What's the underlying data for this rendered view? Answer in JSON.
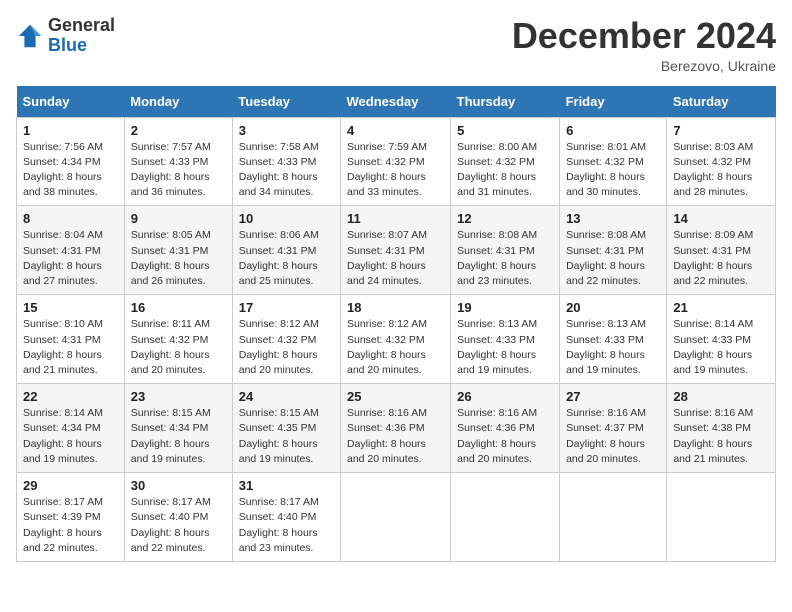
{
  "logo": {
    "general": "General",
    "blue": "Blue"
  },
  "title": "December 2024",
  "location": "Berezovo, Ukraine",
  "days_of_week": [
    "Sunday",
    "Monday",
    "Tuesday",
    "Wednesday",
    "Thursday",
    "Friday",
    "Saturday"
  ],
  "weeks": [
    [
      {
        "day": "1",
        "sunrise": "7:56 AM",
        "sunset": "4:34 PM",
        "daylight": "8 hours and 38 minutes."
      },
      {
        "day": "2",
        "sunrise": "7:57 AM",
        "sunset": "4:33 PM",
        "daylight": "8 hours and 36 minutes."
      },
      {
        "day": "3",
        "sunrise": "7:58 AM",
        "sunset": "4:33 PM",
        "daylight": "8 hours and 34 minutes."
      },
      {
        "day": "4",
        "sunrise": "7:59 AM",
        "sunset": "4:32 PM",
        "daylight": "8 hours and 33 minutes."
      },
      {
        "day": "5",
        "sunrise": "8:00 AM",
        "sunset": "4:32 PM",
        "daylight": "8 hours and 31 minutes."
      },
      {
        "day": "6",
        "sunrise": "8:01 AM",
        "sunset": "4:32 PM",
        "daylight": "8 hours and 30 minutes."
      },
      {
        "day": "7",
        "sunrise": "8:03 AM",
        "sunset": "4:32 PM",
        "daylight": "8 hours and 28 minutes."
      }
    ],
    [
      {
        "day": "8",
        "sunrise": "8:04 AM",
        "sunset": "4:31 PM",
        "daylight": "8 hours and 27 minutes."
      },
      {
        "day": "9",
        "sunrise": "8:05 AM",
        "sunset": "4:31 PM",
        "daylight": "8 hours and 26 minutes."
      },
      {
        "day": "10",
        "sunrise": "8:06 AM",
        "sunset": "4:31 PM",
        "daylight": "8 hours and 25 minutes."
      },
      {
        "day": "11",
        "sunrise": "8:07 AM",
        "sunset": "4:31 PM",
        "daylight": "8 hours and 24 minutes."
      },
      {
        "day": "12",
        "sunrise": "8:08 AM",
        "sunset": "4:31 PM",
        "daylight": "8 hours and 23 minutes."
      },
      {
        "day": "13",
        "sunrise": "8:08 AM",
        "sunset": "4:31 PM",
        "daylight": "8 hours and 22 minutes."
      },
      {
        "day": "14",
        "sunrise": "8:09 AM",
        "sunset": "4:31 PM",
        "daylight": "8 hours and 22 minutes."
      }
    ],
    [
      {
        "day": "15",
        "sunrise": "8:10 AM",
        "sunset": "4:31 PM",
        "daylight": "8 hours and 21 minutes."
      },
      {
        "day": "16",
        "sunrise": "8:11 AM",
        "sunset": "4:32 PM",
        "daylight": "8 hours and 20 minutes."
      },
      {
        "day": "17",
        "sunrise": "8:12 AM",
        "sunset": "4:32 PM",
        "daylight": "8 hours and 20 minutes."
      },
      {
        "day": "18",
        "sunrise": "8:12 AM",
        "sunset": "4:32 PM",
        "daylight": "8 hours and 20 minutes."
      },
      {
        "day": "19",
        "sunrise": "8:13 AM",
        "sunset": "4:33 PM",
        "daylight": "8 hours and 19 minutes."
      },
      {
        "day": "20",
        "sunrise": "8:13 AM",
        "sunset": "4:33 PM",
        "daylight": "8 hours and 19 minutes."
      },
      {
        "day": "21",
        "sunrise": "8:14 AM",
        "sunset": "4:33 PM",
        "daylight": "8 hours and 19 minutes."
      }
    ],
    [
      {
        "day": "22",
        "sunrise": "8:14 AM",
        "sunset": "4:34 PM",
        "daylight": "8 hours and 19 minutes."
      },
      {
        "day": "23",
        "sunrise": "8:15 AM",
        "sunset": "4:34 PM",
        "daylight": "8 hours and 19 minutes."
      },
      {
        "day": "24",
        "sunrise": "8:15 AM",
        "sunset": "4:35 PM",
        "daylight": "8 hours and 19 minutes."
      },
      {
        "day": "25",
        "sunrise": "8:16 AM",
        "sunset": "4:36 PM",
        "daylight": "8 hours and 20 minutes."
      },
      {
        "day": "26",
        "sunrise": "8:16 AM",
        "sunset": "4:36 PM",
        "daylight": "8 hours and 20 minutes."
      },
      {
        "day": "27",
        "sunrise": "8:16 AM",
        "sunset": "4:37 PM",
        "daylight": "8 hours and 20 minutes."
      },
      {
        "day": "28",
        "sunrise": "8:16 AM",
        "sunset": "4:38 PM",
        "daylight": "8 hours and 21 minutes."
      }
    ],
    [
      {
        "day": "29",
        "sunrise": "8:17 AM",
        "sunset": "4:39 PM",
        "daylight": "8 hours and 22 minutes."
      },
      {
        "day": "30",
        "sunrise": "8:17 AM",
        "sunset": "4:40 PM",
        "daylight": "8 hours and 22 minutes."
      },
      {
        "day": "31",
        "sunrise": "8:17 AM",
        "sunset": "4:40 PM",
        "daylight": "8 hours and 23 minutes."
      },
      null,
      null,
      null,
      null
    ]
  ],
  "labels": {
    "sunrise": "Sunrise:",
    "sunset": "Sunset:",
    "daylight": "Daylight:"
  }
}
